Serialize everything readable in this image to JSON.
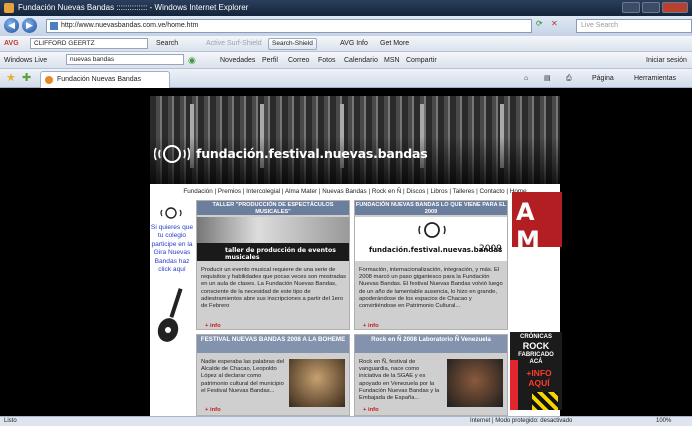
{
  "window": {
    "title": "Fundación Nuevas Bandas :::::::::::::: - Windows Internet Explorer"
  },
  "address_bar": {
    "url": "http://www.nuevasbandas.com.ve/home.htm",
    "search_placeholder": "Live Search"
  },
  "toolbar_avg": {
    "brand": "AVG",
    "user_field": "CLIFFORD GEERTZ",
    "search_label": "Search",
    "active_shield": "Active Surf-Shield",
    "search_shield": "Search-Shield",
    "avg_info": "AVG Info",
    "get_more": "Get More"
  },
  "toolbar_live": {
    "brand": "Windows Live",
    "search_value": "nuevas bandas",
    "links": [
      "Novedades",
      "Perfil",
      "Correo",
      "Fotos",
      "Calendario",
      "MSN",
      "Compartir"
    ],
    "signin": "Iniciar sesión"
  },
  "tabs": {
    "active_tab": "Fundación Nuevas Bandas ::::::::::::::",
    "page_menu": "Página",
    "tools_menu": "Herramientas"
  },
  "site": {
    "brand": "fundación.festival.nuevas.bandas",
    "nav": [
      "Fundación",
      "Premios",
      "Intercolegial",
      "Alma Mater",
      "Nuevas Bandas",
      "Rock en Ñ",
      "Discos",
      "Libros",
      "Talleres",
      "Contacto",
      "Home"
    ],
    "sidebar_text": "Si quieres que tu colegio participe en la Gira Nuevas Bandas haz click aquí",
    "cards": [
      {
        "title": "TALLER \"PRODUCCIÓN DE ESPECTÁCULOS MUSICALES\"",
        "image_caption": "taller de producción de eventos musicales",
        "body": "Producir un evento musical requiere de una serie de requisitos y habilidades que pocas veces son mostradas en un aula de clases. La Fundación Nuevas Bandas, consciente de la necesidad de este tipo de adiestramientos abre sus inscripciones a partir del 1ero de Febrero",
        "more": "+ info"
      },
      {
        "title": "FUNDACIÓN NUEVAS BANDAS LO QUE VIENE PARA EL 2009",
        "image_caption": "fundación.festival.nuevas.bandas",
        "year": "2009",
        "body": "Formación, internacionalización, integración, y más. El 2008 marcó un paso gigantesco para la Fundación Nuevas Bandas. El festival Nuevas Bandas volvió luego de un año de lamentable ausencia, lo hizo en grande, apoderándose de los espacios de Chacao y convirtiéndose en Patrimonio Cultural...",
        "more": "+ info"
      },
      {
        "title": "FESTIVAL NUEVAS BANDAS 2008 A LA BOHEME",
        "body": "Nadie esperaba las palabras del Alcalde de Chacao, Leopoldo López al declarar como patrimonio cultural del municipio el Festival Nuevas Bandas...",
        "more": "+ info"
      },
      {
        "title": "Rock en Ñ 2008 Laboratorio Ñ Venezuela",
        "body": "Rock en Ñ, festival de vanguardia, nace como iniciativa de la SGAE y es apoyado en Venezuela por la Fundación Nuevas Bandas y la Embajada de España...",
        "more": "+ info"
      }
    ],
    "ad_top": "A M",
    "ad_side": {
      "line1": "CRÓNICAS",
      "line2": "ROCK",
      "line3": "FABRICADO",
      "line4": "ACÁ",
      "line5": "+INFO",
      "line6": "AQUÍ"
    }
  },
  "status_bar": {
    "left": "Listo",
    "zone": "Internet | Modo protegido: desactivado",
    "zoom": "100%"
  },
  "colors": {
    "link_blue": "#2a3cc9",
    "card_head": "#6c7e9e",
    "info_red": "#c41d1d"
  }
}
